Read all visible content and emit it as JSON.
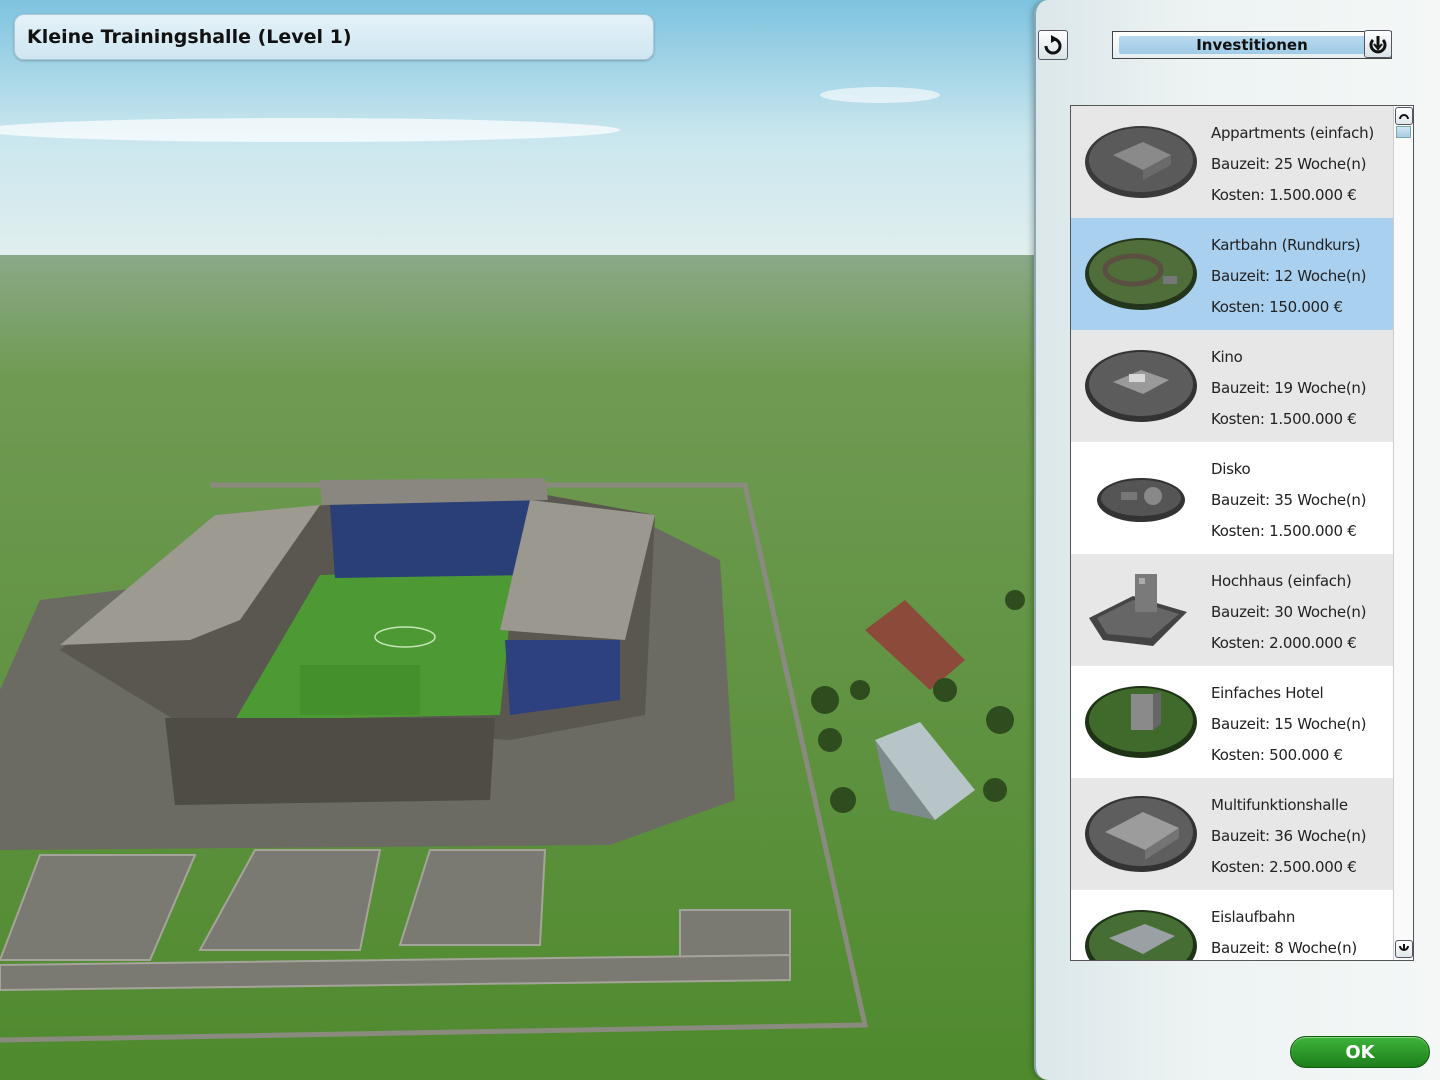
{
  "scene": {
    "building_title": "Kleine Trainingshalle (Level 1)"
  },
  "panel": {
    "header_label": "Investitionen",
    "ok_label": "OK",
    "back_icon": "rotate-arrow-icon",
    "menu_icon": "power-down-icon"
  },
  "investments": [
    {
      "name": "Appartments (einfach)",
      "bauzeit": "Bauzeit: 25 Woche(n)",
      "kosten": "Kosten: 1.500.000 €"
    },
    {
      "name": "Kartbahn (Rundkurs)",
      "bauzeit": "Bauzeit: 12 Woche(n)",
      "kosten": "Kosten: 150.000 €"
    },
    {
      "name": "Kino",
      "bauzeit": "Bauzeit: 19 Woche(n)",
      "kosten": "Kosten: 1.500.000 €"
    },
    {
      "name": "Disko",
      "bauzeit": "Bauzeit: 35 Woche(n)",
      "kosten": "Kosten: 1.500.000 €"
    },
    {
      "name": "Hochhaus (einfach)",
      "bauzeit": "Bauzeit: 30 Woche(n)",
      "kosten": "Kosten: 2.000.000 €"
    },
    {
      "name": "Einfaches Hotel",
      "bauzeit": "Bauzeit: 15 Woche(n)",
      "kosten": "Kosten: 500.000 €"
    },
    {
      "name": "Multifunktionshalle",
      "bauzeit": "Bauzeit: 36 Woche(n)",
      "kosten": "Kosten: 2.500.000 €"
    },
    {
      "name": "Eislaufbahn",
      "bauzeit": "Bauzeit: 8 Woche(n)",
      "kosten": ""
    }
  ],
  "selected_index": 1
}
